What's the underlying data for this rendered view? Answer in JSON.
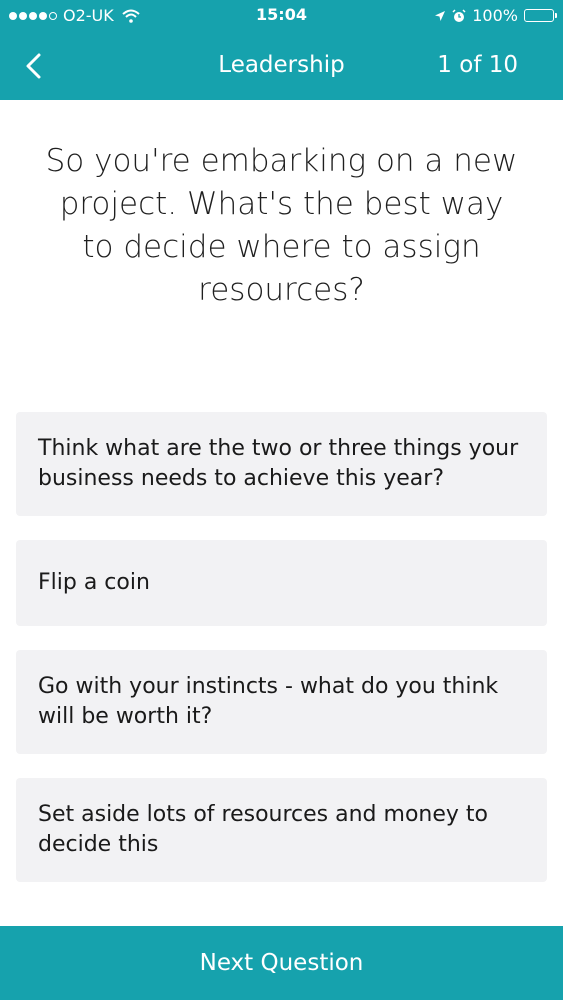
{
  "status_bar": {
    "carrier": "O2-UK",
    "time": "15:04",
    "battery": "100%",
    "signal_icon": "signal-dots-icon",
    "wifi_icon": "wifi-icon",
    "location_icon": "location-arrow-icon",
    "alarm_icon": "alarm-clock-icon",
    "battery_icon": "battery-icon"
  },
  "nav": {
    "back_icon": "chevron-left-icon",
    "title": "Leadership",
    "counter": "1 of 10"
  },
  "question": {
    "text": "So you're embarking on a new project. What's the best way to decide where to assign resources?"
  },
  "answers": [
    {
      "label": "Think what are the two or three things your business needs to achieve this year?"
    },
    {
      "label": "Flip a coin"
    },
    {
      "label": "Go with your instincts - what do you think will be worth it?"
    },
    {
      "label": "Set aside lots of resources and money to decide this"
    }
  ],
  "footer": {
    "next_label": "Next Question"
  },
  "colors": {
    "brand": "#16a2ad",
    "answer_background": "#f2f2f4"
  }
}
